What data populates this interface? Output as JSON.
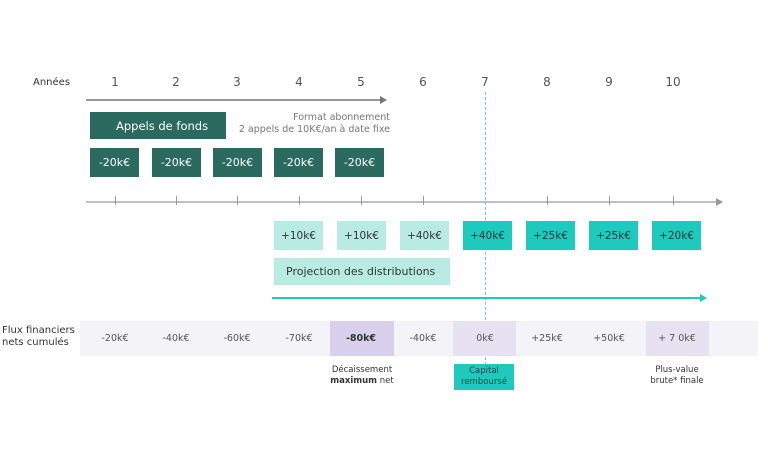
{
  "header": {
    "years_label": "Années"
  },
  "years": [
    "1",
    "2",
    "3",
    "4",
    "5",
    "6",
    "7",
    "8",
    "9",
    "10"
  ],
  "calls": {
    "title": "Appels de fonds",
    "format_line1": "Format abonnement",
    "format_line2": "2 appels de 10K€/an à date fixe",
    "amounts": [
      "-20k€",
      "-20k€",
      "-20k€",
      "-20k€",
      "-20k€"
    ]
  },
  "distributions": {
    "amounts": [
      "+10k€",
      "+10k€",
      "+40k€",
      "+40k€",
      "+25k€",
      "+25k€",
      "+20k€"
    ],
    "projection_label": "Projection des distributions"
  },
  "cumulative": {
    "label_line1": "Flux financiers",
    "label_line2": "nets cumulés",
    "values": [
      "-20k€",
      "-40k€",
      "-60k€",
      "-70k€",
      "-80k€",
      "-40k€",
      "0k€",
      "+25k€",
      "+50k€",
      "+ 7 0k€"
    ]
  },
  "notes": {
    "max_line1": "Décaissement",
    "max_bold": "maximum",
    "max_rest": " net",
    "capital_line1": "Capital",
    "capital_line2": "remboursé",
    "final_line1": "Plus-value",
    "final_line2": "brute* finale"
  },
  "colors": {
    "dark_teal": "#2a6a5f",
    "light_mint": "#b8ece2",
    "bright_teal": "#1ec9be",
    "lavender": "#d8d0ec",
    "band": "#f3f3f8"
  }
}
